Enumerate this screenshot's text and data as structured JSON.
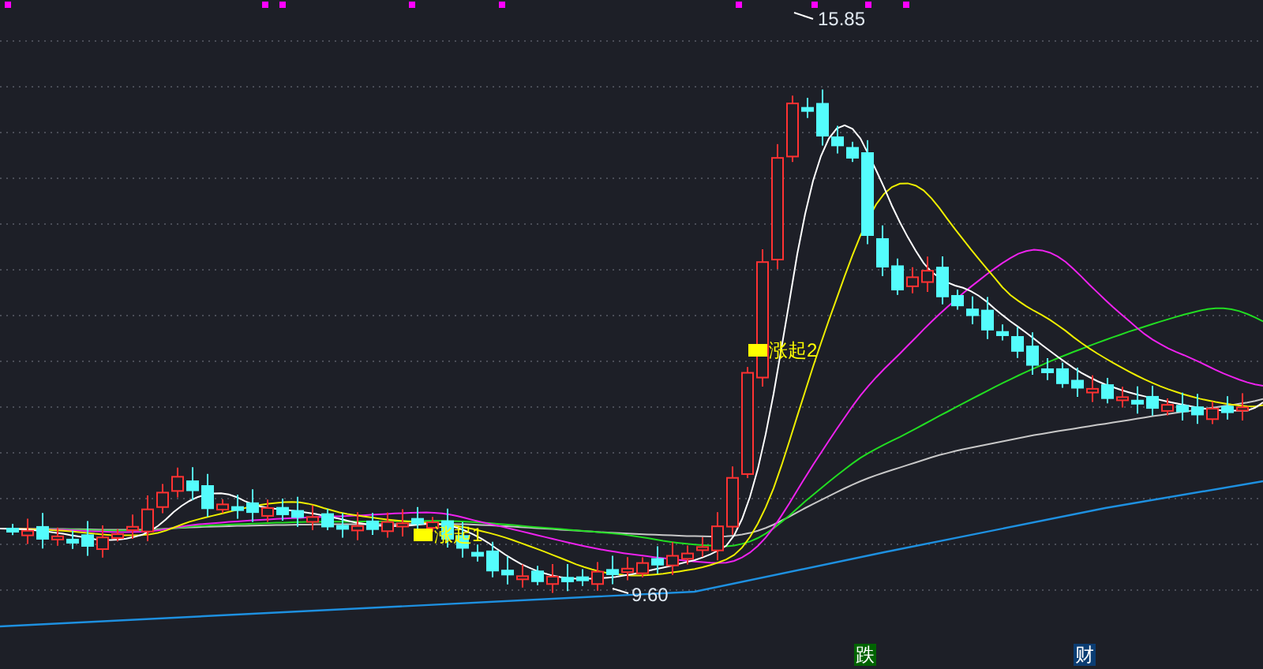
{
  "chart": {
    "high_label": "15.85",
    "low_label": "9.60",
    "signals": [
      {
        "text": "涨起2"
      },
      {
        "text": "涨起1"
      }
    ],
    "bottom_markers": [
      {
        "text": "跌",
        "color": "#006400"
      },
      {
        "text": "财",
        "color": "#0b3d73"
      }
    ]
  }
}
